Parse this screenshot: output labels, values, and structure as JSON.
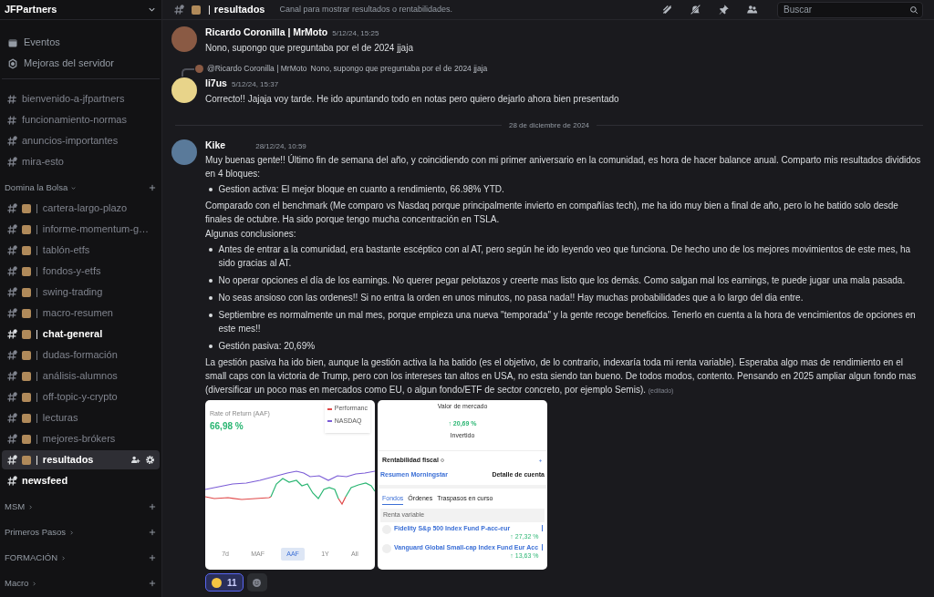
{
  "server": {
    "name": "JFPartners"
  },
  "sidebar": {
    "top_items": [
      {
        "kind": "events",
        "label": "Eventos"
      },
      {
        "kind": "boost",
        "label": "Mejoras del servidor"
      }
    ],
    "channels": [
      {
        "name": "bienvenido-a-jfpartners",
        "kind": "text",
        "unread": false
      },
      {
        "name": "funcionamiento-normas",
        "kind": "text",
        "unread": false
      },
      {
        "name": "anuncios-importantes",
        "kind": "announcement",
        "unread": false
      },
      {
        "name": "mira-esto",
        "kind": "announcement",
        "unread": false
      }
    ],
    "categories": [
      {
        "name": "Domina la Bolsa",
        "expanded": true,
        "channels": [
          {
            "separator": "|",
            "name": "cartera-largo-plazo",
            "kind": "announcement",
            "unread": false,
            "selected": false
          },
          {
            "separator": "|",
            "name": "informe-momentum-g…",
            "kind": "announcement",
            "unread": false,
            "selected": false
          },
          {
            "separator": "|",
            "name": "tablón-etfs",
            "kind": "announcement",
            "unread": false,
            "selected": false
          },
          {
            "separator": "|",
            "name": "fondos-y-etfs",
            "kind": "announcement",
            "unread": false,
            "selected": false
          },
          {
            "separator": "|",
            "name": "swing-trading",
            "kind": "announcement",
            "unread": false,
            "selected": false
          },
          {
            "separator": "|",
            "name": "macro-resumen",
            "kind": "announcement",
            "unread": false,
            "selected": false
          },
          {
            "separator": "|",
            "name": "chat-general",
            "kind": "announcement",
            "unread": true,
            "selected": false
          },
          {
            "separator": "|",
            "name": "dudas-formación",
            "kind": "announcement",
            "unread": false,
            "selected": false
          },
          {
            "separator": "|",
            "name": "análisis-alumnos",
            "kind": "announcement",
            "unread": false,
            "selected": false
          },
          {
            "separator": "|",
            "name": "off-topic-y-crypto",
            "kind": "announcement",
            "unread": false,
            "selected": false
          },
          {
            "separator": "|",
            "name": "lecturas",
            "kind": "announcement",
            "unread": false,
            "selected": false
          },
          {
            "separator": "|",
            "name": "mejores-brókers",
            "kind": "announcement",
            "unread": false,
            "selected": false
          },
          {
            "separator": "|",
            "name": "resultados",
            "kind": "announcement",
            "unread": true,
            "selected": true
          },
          {
            "name": "newsfeed",
            "kind": "announcement",
            "unread": true,
            "selected": false
          }
        ]
      },
      {
        "name": "MSM",
        "expanded": false
      },
      {
        "name": "Primeros Pasos",
        "expanded": false
      },
      {
        "name": "FORMACIÓN",
        "expanded": false
      },
      {
        "name": "Macro",
        "expanded": false
      }
    ]
  },
  "header": {
    "separator": "|",
    "channel": "resultados",
    "topic": "Canal para mostrar resultados o rentabilidades.",
    "search": {
      "placeholder": "Buscar"
    }
  },
  "feed": [
    {
      "kind": "message",
      "author": "Ricardo Coronilla | MrMoto",
      "time": "5/12/24, 15:25",
      "blocks": [
        {
          "kind": "p",
          "text": "Nono, supongo que preguntaba por el de 2024 jjaja"
        }
      ]
    },
    {
      "kind": "message",
      "author": "li7us",
      "time": "5/12/24, 15:37",
      "reply": {
        "author": "@Ricardo Coronilla | MrMoto",
        "text": "Nono, supongo que preguntaba por el de 2024 jjaja"
      },
      "blocks": [
        {
          "kind": "p",
          "text": "Correcto!! Jajaja voy tarde. He ido apuntando todo en notas pero quiero dejarlo ahora bien presentado"
        }
      ]
    },
    {
      "kind": "date_divider",
      "text": "28 de diciembre de 2024"
    },
    {
      "kind": "message",
      "author": "Kike",
      "time": "28/12/24, 10:59",
      "blocks": [
        {
          "kind": "p",
          "text": "Muy buenas gente!! Último fin de semana del año, y coincidiendo con mi primer aniversario en la comunidad, es hora de hacer balance anual. Comparto mis resultados divididos en 4 bloques:"
        },
        {
          "kind": "bullet",
          "text": "Gestion activa: El mejor bloque en cuanto a rendimiento, 66.98% YTD."
        },
        {
          "kind": "p",
          "text": "Comparado con el benchmark (Me comparo vs Nasdaq porque principalmente invierto en compañías tech), me ha ido muy bien a final de año, pero lo he batido solo desde finales de octubre. Ha sido porque tengo mucha concentración en TSLA."
        },
        {
          "kind": "p",
          "text": "Algunas conclusiones:"
        },
        {
          "kind": "bullet",
          "text": "Antes de entrar a la comunidad, era bastante escéptico con al AT, pero según he ido leyendo veo que funciona. De hecho uno de los mejores movimientos de este mes, ha sido gracias al AT."
        },
        {
          "kind": "bullet",
          "text": "No operar opciones el día de los earnings. No querer pegar pelotazos y creerte mas listo que los demás. Como salgan mal los earnings, te puede jugar una mala pasada."
        },
        {
          "kind": "bullet",
          "text": "No seas ansioso con las ordenes!! Si no entra la orden en unos minutos, no pasa nada!! Hay muchas probabilidades que a lo largo del dia entre."
        },
        {
          "kind": "bullet",
          "text": "Septiembre es normalmente un mal mes, porque empieza una nueva \"temporada\" y la gente recoge beneficios. Tenerlo en cuenta a la hora de vencimientos de opciones en este mes!!"
        },
        {
          "kind": "bullet",
          "text": "Gestión pasiva: 20,69%"
        },
        {
          "kind": "p",
          "text": "La gestión pasiva ha ido bien, aunque la gestión activa la ha batido (es el objetivo, de lo contrario, indexaría toda mi renta variable). Esperaba algo mas de rendimiento en el small caps con la victoria de Trump, pero con los intereses tan altos en USA, no esta siendo tan bueno. De todos modos, contento. Pensando en 2025 ampliar algun fondo mas (diversificar un poco mas en mercados como EU, o algun fondo/ETF de sector concreto, por ejemplo Semis).",
          "edited": "(editado)"
        }
      ],
      "attachments": [
        {
          "kind": "performance",
          "title": "Rate of Return (AAF)",
          "value": "66,98 %",
          "legend": [
            {
              "label": "Performanc",
              "color": "#e04848"
            },
            {
              "label": "NASDAQ",
              "color": "#7b5cd6"
            }
          ],
          "ranges": [
            {
              "label": "7d",
              "selected": false
            },
            {
              "label": "MAF",
              "selected": false
            },
            {
              "label": "AAF",
              "selected": true
            },
            {
              "label": "1Y",
              "selected": false
            },
            {
              "label": "All",
              "selected": false
            }
          ]
        },
        {
          "kind": "portfolio",
          "market_label": "Valor de mercado",
          "change": "↑ 20,69 %",
          "invested_label": "Invertido",
          "fiscal": "Rentabilidad fiscal",
          "links": [
            "Resumen Morningstar",
            "Detalle de cuenta"
          ],
          "tabs": [
            {
              "label": "Fondos",
              "selected": true
            },
            {
              "label": "Órdenes",
              "selected": false
            },
            {
              "label": "Traspasos en curso",
              "selected": false
            }
          ],
          "section": "Renta variable",
          "funds": [
            {
              "name": "Fidelity S&p 500 Index Fund P-acc-eur",
              "change": "↑ 27,32 %"
            },
            {
              "name": "Vanguard Global Small-cap Index Fund Eur Acc",
              "change": "↑ 13,63 %"
            }
          ]
        }
      ],
      "reactions": [
        {
          "count": "11",
          "selected": true
        }
      ]
    }
  ]
}
